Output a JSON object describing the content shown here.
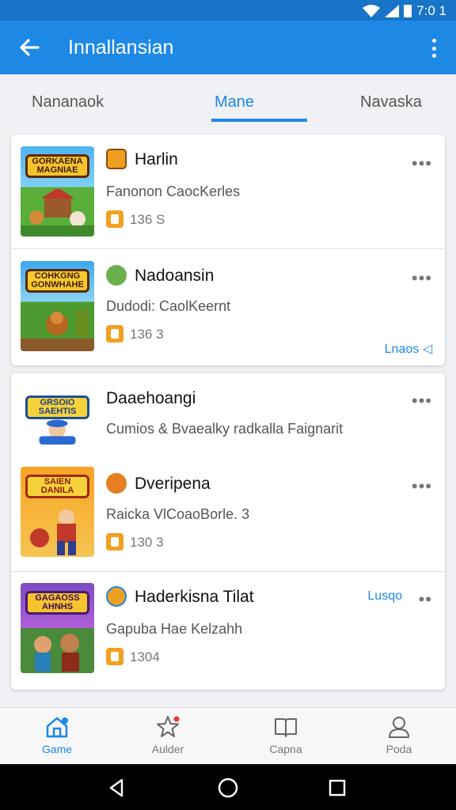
{
  "status_bar": {
    "time": "7:0 1"
  },
  "app_bar": {
    "title": "Innallansian"
  },
  "tabs": [
    {
      "label": "Nananaok"
    },
    {
      "label": "Mane",
      "active": true
    },
    {
      "label": "Navaska"
    }
  ],
  "card1": {
    "items": [
      {
        "thumb_text": "GORKAENA MAGNIAE",
        "name": "Harlin",
        "subtitle": "Fanonon CaocKerles",
        "count": "136 S"
      },
      {
        "thumb_text": "COHKGNG GONWHAHE",
        "name": "Nadoansin",
        "subtitle": "Dudodi: CaolKeernt",
        "count": "136 3"
      }
    ],
    "link": "Lnaos ◁"
  },
  "card2": {
    "items": [
      {
        "thumb_text": "GRSOIO SAEHTIS",
        "name": "Daaehoangi",
        "subtitle": "Cumios & Bvaealky radkalla Faignarit"
      },
      {
        "thumb_text": "SAIEN DANILA",
        "name": "Dveripena",
        "subtitle": "Raicka VlCoaoBorle.  3",
        "count": "130 3"
      },
      {
        "thumb_text": "GAGAOSS AHNHS",
        "name": "Haderkisna Tilat",
        "subtitle": "Gapuba Hae Kelzahh",
        "count": "1304",
        "link": "Lusqo"
      }
    ]
  },
  "bottom_nav": [
    {
      "label": "Game",
      "icon": "home-icon",
      "active": true
    },
    {
      "label": "Aulder",
      "icon": "star-icon"
    },
    {
      "label": "Capna",
      "icon": "book-icon"
    },
    {
      "label": "Poda",
      "icon": "person-icon"
    }
  ],
  "colors": {
    "primary": "#1e88e5",
    "status_bar": "#1874c6",
    "badge": "#f2a020"
  }
}
